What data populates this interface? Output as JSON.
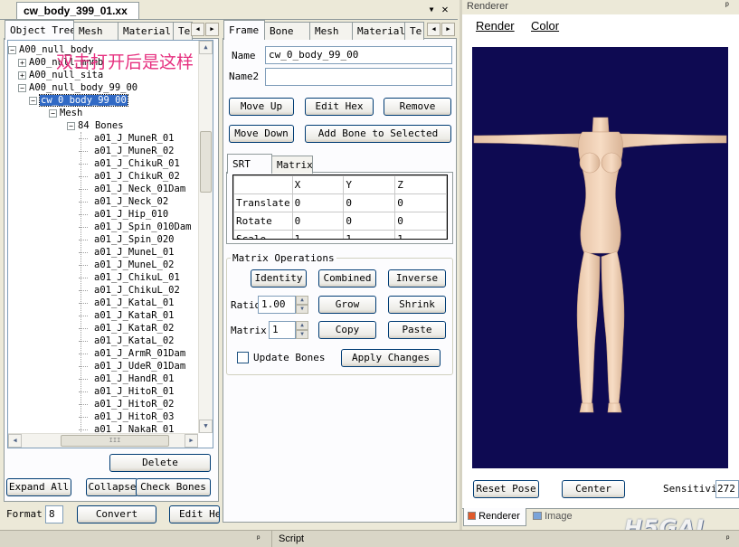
{
  "document": {
    "tab_title": "cw_body_399_01.xx",
    "dropdown_glyph": "▼",
    "close_glyph": "✕"
  },
  "left_tabs": [
    "Object Tree",
    "Mesh",
    "Material",
    "Te"
  ],
  "tree": {
    "rows": [
      {
        "text": "A00_null_body",
        "depth": 0,
        "expander": "⊟"
      },
      {
        "text": "A00_null_mnmb",
        "depth": 1,
        "expander": "⊞"
      },
      {
        "text": "A00_null_sita",
        "depth": 1,
        "expander": "⊞"
      },
      {
        "text": "A00_null_body_99_00",
        "depth": 1,
        "expander": "⊟"
      },
      {
        "text": "cw_0_body_99_00",
        "depth": 2,
        "expander": "⊟",
        "selected": true
      },
      {
        "text": "Mesh",
        "depth": 3,
        "expander": "⊟"
      },
      {
        "text": "84 Bones",
        "depth": 4,
        "expander": "⊟"
      },
      {
        "text": "a01_J_MuneR_01",
        "depth": 5
      },
      {
        "text": "a01_J_MuneR_02",
        "depth": 5
      },
      {
        "text": "a01_J_ChikuR_01",
        "depth": 5
      },
      {
        "text": "a01_J_ChikuR_02",
        "depth": 5
      },
      {
        "text": "a01_J_Neck_01Dam",
        "depth": 5
      },
      {
        "text": "a01_J_Neck_02",
        "depth": 5
      },
      {
        "text": "a01_J_Hip_010",
        "depth": 5
      },
      {
        "text": "a01_J_Spin_010Dam",
        "depth": 5
      },
      {
        "text": "a01_J_Spin_020",
        "depth": 5
      },
      {
        "text": "a01_J_MuneL_01",
        "depth": 5
      },
      {
        "text": "a01_J_MuneL_02",
        "depth": 5
      },
      {
        "text": "a01_J_ChikuL_01",
        "depth": 5
      },
      {
        "text": "a01_J_ChikuL_02",
        "depth": 5
      },
      {
        "text": "a01_J_KataL_01",
        "depth": 5
      },
      {
        "text": "a01_J_KataR_01",
        "depth": 5
      },
      {
        "text": "a01_J_KataR_02",
        "depth": 5
      },
      {
        "text": "a01_J_KataL_02",
        "depth": 5
      },
      {
        "text": "a01_J_ArmR_01Dam",
        "depth": 5
      },
      {
        "text": "a01_J_UdeR_01Dam",
        "depth": 5
      },
      {
        "text": "a01_J_HandR_01",
        "depth": 5
      },
      {
        "text": "a01_J_HitoR_01",
        "depth": 5
      },
      {
        "text": "a01_J_HitoR_02",
        "depth": 5
      },
      {
        "text": "a01_J_HitoR_03",
        "depth": 5
      },
      {
        "text": "a01_J_NakaR_01",
        "depth": 5
      }
    ],
    "hscroll_grip": "III"
  },
  "overlay_annotation": "双击打开后是这样",
  "left_buttons": {
    "delete": "Delete",
    "expand_all": "Expand All",
    "collapse": "Collapse",
    "check_bones": "Check Bones",
    "format_label": "Format",
    "format_value": "8",
    "convert": "Convert",
    "edit_hex": "Edit He"
  },
  "mid_tabs": [
    "Frame",
    "Bone",
    "Mesh",
    "Material",
    "Te"
  ],
  "frame": {
    "name_label": "Name",
    "name_value": "cw_0_body_99_00",
    "name2_label": "Name2",
    "name2_value": "",
    "move_up": "Move Up",
    "edit_hex": "Edit Hex",
    "remove": "Remove",
    "move_down": "Move Down",
    "add_bone": "Add Bone to Selected",
    "srt_tabs": [
      "SRT",
      "Matrix"
    ],
    "grid_headers": [
      "",
      "X",
      "Y",
      "Z"
    ],
    "grid_rows": [
      {
        "label": "Translate",
        "values": [
          "0",
          "0",
          "0"
        ]
      },
      {
        "label": "Rotate",
        "values": [
          "0",
          "0",
          "0"
        ]
      },
      {
        "label": "Scale",
        "values": [
          "1",
          "1",
          "1"
        ]
      }
    ],
    "matrix_ops_label": "Matrix Operations",
    "identity": "Identity",
    "combined": "Combined",
    "inverse": "Inverse",
    "ratio_label": "Ratio",
    "ratio_value": "1.00",
    "grow": "Grow",
    "shrink": "Shrink",
    "matrix_num_label": "Matrix #",
    "matrix_num_value": "1",
    "copy": "Copy",
    "paste": "Paste",
    "update_bones_label": "Update Bones",
    "update_bones_checked": false,
    "apply_changes": "Apply Changes"
  },
  "renderer": {
    "title": "Renderer",
    "pin_glyph": "ᵖ",
    "menu": [
      "Render",
      "Color"
    ],
    "viewport_color": "#0e0a52",
    "reset_pose": "Reset Pose",
    "center": "Center",
    "sensitivity_label": "Sensitivit",
    "sensitivity_value": "272",
    "bottom_tabs": [
      "Renderer",
      "Image"
    ],
    "watermark": "H5GAL"
  },
  "bottom_bar": {
    "script_label": "Script"
  }
}
